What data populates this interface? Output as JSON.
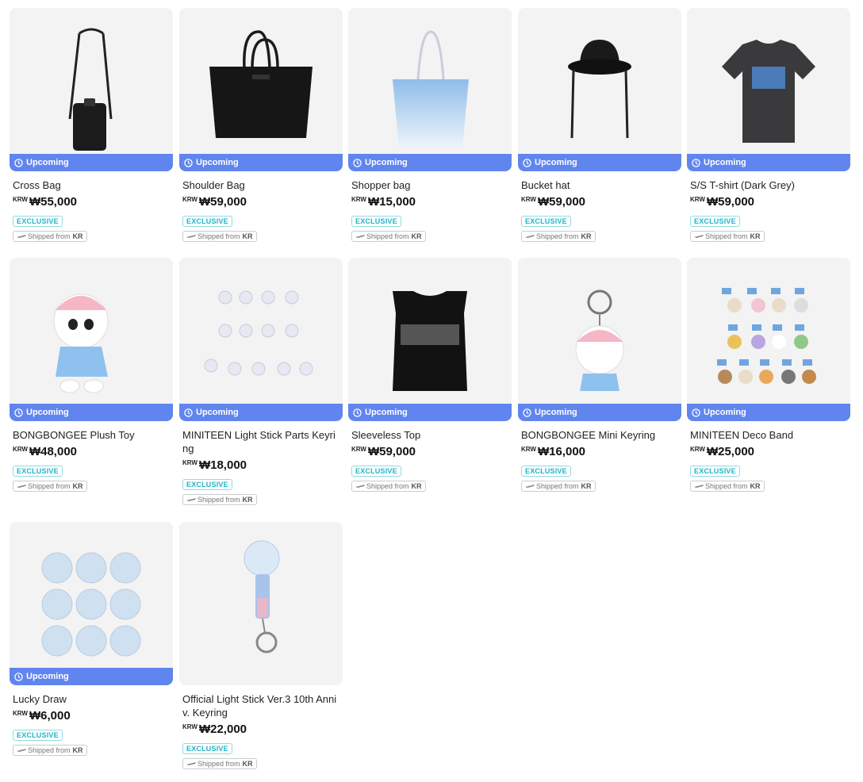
{
  "labels": {
    "upcoming": "Upcoming",
    "exclusive": "EXCLUSIVE",
    "shipped_from": "Shipped from",
    "ship_country": "KR",
    "currency": "KRW"
  },
  "products": [
    {
      "name": "Cross Bag",
      "price": "₩55,000",
      "image_icon": "cross-bag"
    },
    {
      "name": "Shoulder Bag",
      "price": "₩59,000",
      "image_icon": "shoulder-bag"
    },
    {
      "name": "Shopper bag",
      "price": "₩15,000",
      "image_icon": "shopper-bag"
    },
    {
      "name": "Bucket hat",
      "price": "₩59,000",
      "image_icon": "bucket-hat"
    },
    {
      "name": "S/S T-shirt (Dark Grey)",
      "price": "₩59,000",
      "image_icon": "t-shirt"
    },
    {
      "name": "BONGBONGEE Plush Toy",
      "price": "₩48,000",
      "image_icon": "plush-toy"
    },
    {
      "name": "MINITEEN Light Stick Parts Keyring",
      "price": "₩18,000",
      "image_icon": "keyring-set"
    },
    {
      "name": "Sleeveless Top",
      "price": "₩59,000",
      "image_icon": "sleeveless-top"
    },
    {
      "name": "BONGBONGEE Mini Keyring",
      "price": "₩16,000",
      "image_icon": "mini-keyring"
    },
    {
      "name": "MINITEEN Deco Band",
      "price": "₩25,000",
      "image_icon": "deco-band"
    },
    {
      "name": "Lucky Draw",
      "price": "₩6,000",
      "image_icon": "photo-badges"
    },
    {
      "name": "Official Light Stick Ver.3 10th Anniv. Keyring",
      "price": "₩22,000",
      "image_icon": "light-stick-keyring"
    }
  ],
  "colors": {
    "upcoming_badge": "#6185ee",
    "exclusive_tag": "#22b3c6",
    "thumb_bg": "#f3f3f3"
  }
}
